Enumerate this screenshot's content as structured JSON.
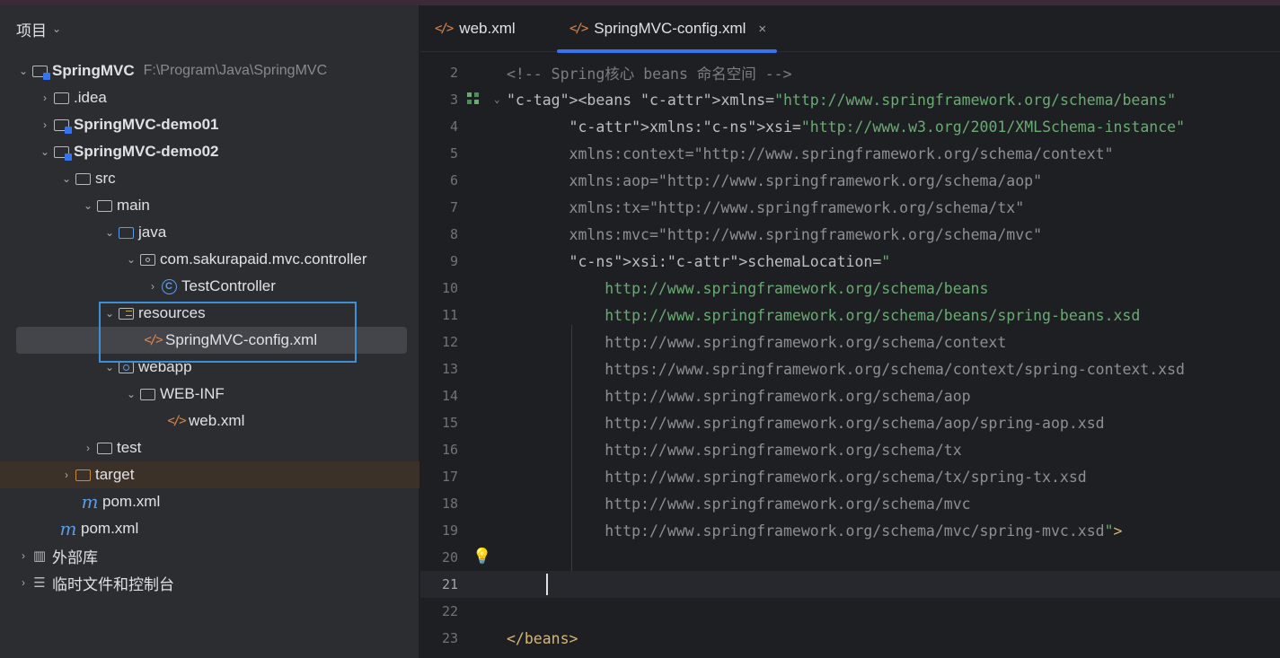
{
  "project_panel": {
    "title": "项目",
    "tree": [
      {
        "label": "SpringMVC",
        "path": "F:\\Program\\Java\\SpringMVC"
      },
      {
        "label": ".idea"
      },
      {
        "label": "SpringMVC-demo01"
      },
      {
        "label": "SpringMVC-demo02"
      },
      {
        "label": "src"
      },
      {
        "label": "main"
      },
      {
        "label": "java"
      },
      {
        "label": "com.sakurapaid.mvc.controller"
      },
      {
        "label": "TestController"
      },
      {
        "label": "resources"
      },
      {
        "label": "SpringMVC-config.xml"
      },
      {
        "label": "webapp"
      },
      {
        "label": "WEB-INF"
      },
      {
        "label": "web.xml"
      },
      {
        "label": "test"
      },
      {
        "label": "target"
      },
      {
        "label": "pom.xml"
      },
      {
        "label": "pom.xml"
      },
      {
        "label": "外部库"
      },
      {
        "label": "临时文件和控制台"
      }
    ]
  },
  "editor": {
    "tabs": [
      {
        "label": "web.xml"
      },
      {
        "label": "SpringMVC-config.xml",
        "close": "×"
      }
    ],
    "lines": [
      {
        "n": "2",
        "t": "<!-- Spring核心 beans 命名空间 -->"
      },
      {
        "n": "3",
        "t": "<beans xmlns=\"http://www.springframework.org/schema/beans\""
      },
      {
        "n": "4",
        "t": "       xmlns:xsi=\"http://www.w3.org/2001/XMLSchema-instance\""
      },
      {
        "n": "5",
        "t": "       xmlns:context=\"http://www.springframework.org/schema/context\""
      },
      {
        "n": "6",
        "t": "       xmlns:aop=\"http://www.springframework.org/schema/aop\""
      },
      {
        "n": "7",
        "t": "       xmlns:tx=\"http://www.springframework.org/schema/tx\""
      },
      {
        "n": "8",
        "t": "       xmlns:mvc=\"http://www.springframework.org/schema/mvc\""
      },
      {
        "n": "9",
        "t": "       xsi:schemaLocation=\""
      },
      {
        "n": "10",
        "t": "           http://www.springframework.org/schema/beans"
      },
      {
        "n": "11",
        "t": "           http://www.springframework.org/schema/beans/spring-beans.xsd"
      },
      {
        "n": "12",
        "t": "           http://www.springframework.org/schema/context"
      },
      {
        "n": "13",
        "t": "           https://www.springframework.org/schema/context/spring-context.xsd"
      },
      {
        "n": "14",
        "t": "           http://www.springframework.org/schema/aop"
      },
      {
        "n": "15",
        "t": "           http://www.springframework.org/schema/aop/spring-aop.xsd"
      },
      {
        "n": "16",
        "t": "           http://www.springframework.org/schema/tx"
      },
      {
        "n": "17",
        "t": "           http://www.springframework.org/schema/tx/spring-tx.xsd"
      },
      {
        "n": "18",
        "t": "           http://www.springframework.org/schema/mvc"
      },
      {
        "n": "19",
        "t": "           http://www.springframework.org/schema/mvc/spring-mvc.xsd\">"
      },
      {
        "n": "20",
        "t": ""
      },
      {
        "n": "21",
        "t": ""
      },
      {
        "n": "22",
        "t": ""
      },
      {
        "n": "23",
        "t": "</beans>"
      }
    ]
  },
  "colors": {
    "accent": "#3574f0",
    "selection_box": "#3d8fd6",
    "string": "#6aab73",
    "tag": "#d5b778",
    "namespace": "#c77dbb",
    "comment": "#7a7e85"
  }
}
